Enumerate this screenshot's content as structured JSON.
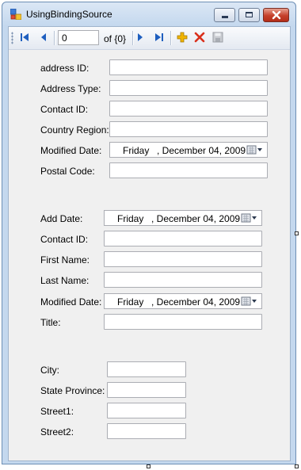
{
  "window": {
    "title": "UsingBindingSource",
    "controls": [
      "minimize-icon",
      "maximize-icon",
      "close-icon"
    ]
  },
  "navigator": {
    "position": "0",
    "count_label": "of {0}",
    "icons": [
      "move-first-icon",
      "move-previous-icon",
      "move-next-icon",
      "move-last-icon",
      "add-new-icon",
      "delete-icon",
      "save-icon"
    ]
  },
  "address": {
    "address_id_label": "address ID:",
    "address_type_label": "Address Type:",
    "contact_id_label": "Contact ID:",
    "country_region_label": "Country Region:",
    "modified_date_label": "Modified Date:",
    "modified_date_day": "Friday",
    "modified_date_date": ", December 04, 2009",
    "postal_code_label": "Postal Code:"
  },
  "contact": {
    "add_date_label": "Add Date:",
    "add_date_day": "Friday",
    "add_date_date": ", December 04, 2009",
    "contact_id_label": "Contact ID:",
    "first_name_label": "First Name:",
    "last_name_label": "Last Name:",
    "modified_date_label": "Modified Date:",
    "modified_date_day": "Friday",
    "modified_date_date": ", December 04, 2009",
    "title_label": "Title:"
  },
  "location": {
    "city_label": "City:",
    "state_province_label": "State Province:",
    "street1_label": "Street1:",
    "street2_label": "Street2:"
  },
  "colors": {
    "title_bar": "#c4d8ee",
    "client_bg": "#f0f0f0",
    "close_button": "#c5402b",
    "nav_arrow": "#1f5fbf",
    "add_icon": "#f0b400",
    "delete_icon": "#d9301c"
  }
}
